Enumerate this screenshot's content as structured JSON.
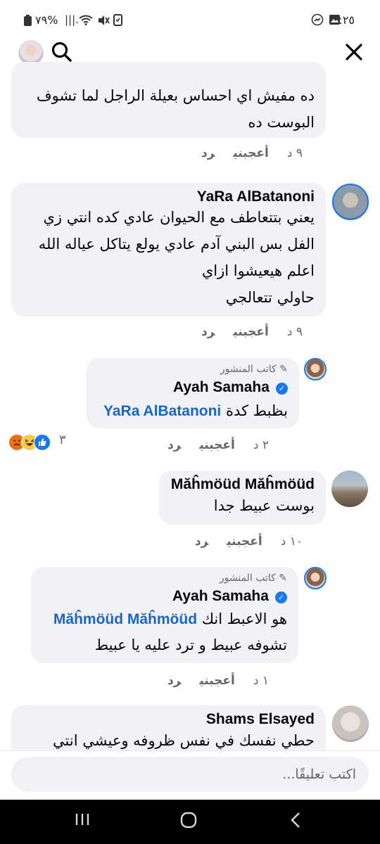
{
  "status_bar": {
    "time": "٠:٢٥",
    "battery": "%٧٩",
    "signal": "|||."
  },
  "comments": [
    {
      "lines": [
        "ده مفيش اي احساس بعيلة الراجل لما تشوف",
        "البوست ده"
      ],
      "time": "٩ د",
      "like": "أعجبني",
      "reply": "رد"
    },
    {
      "name": "YaRa AlBatanoni",
      "lines": [
        "يعني بتتعاطف مع الحيوان عادي كده انتي زي",
        "الفل بس البني آدم عادي يولع يتاكل عياله الله",
        "اعلم هيعيشوا ازاي",
        "حاولي تتعالجي"
      ],
      "time": "٩ د",
      "like": "أعجبني",
      "reply": "رد"
    },
    {
      "badge": "كاتب المنشور",
      "name": "Ayah Samaha",
      "mention": "YaRa AlBatanoni",
      "text": "بظبط كدة",
      "time": "٢ د",
      "like": "أعجبني",
      "reply": "رد",
      "reaction_count": "٣"
    },
    {
      "name": "Măĥmöüd Măĥmöüd",
      "text": "بوست عبيط جدا",
      "time": "١٠ د",
      "like": "أعجبني",
      "reply": "رد"
    },
    {
      "badge": "كاتب المنشور",
      "name": "Ayah Samaha",
      "mention": "Măĥmöüd Măĥmöüd",
      "text1": "هو الاعبط انك",
      "text2": "تشوفه عبيط و ترد عليه يا عبيط",
      "time": "١ د",
      "like": "أعجبني",
      "reply": "رد"
    },
    {
      "name": "Shams Elsayed",
      "text": "حطي نفسك في نفس ظروفه وعيشي انتي"
    }
  ],
  "composer": {
    "placeholder": "اكتب تعليقًا..."
  },
  "colors": {
    "bubble": "#f0f2f5",
    "link": "#1a66c4",
    "verified": "#1877f2",
    "muted": "#65676b"
  },
  "icons": [
    "search-icon",
    "close-icon",
    "like-reaction-icon",
    "haha-reaction-icon",
    "angry-reaction-icon",
    "pen-icon",
    "verified-badge-icon",
    "recent-apps-icon",
    "home-icon",
    "back-icon"
  ]
}
